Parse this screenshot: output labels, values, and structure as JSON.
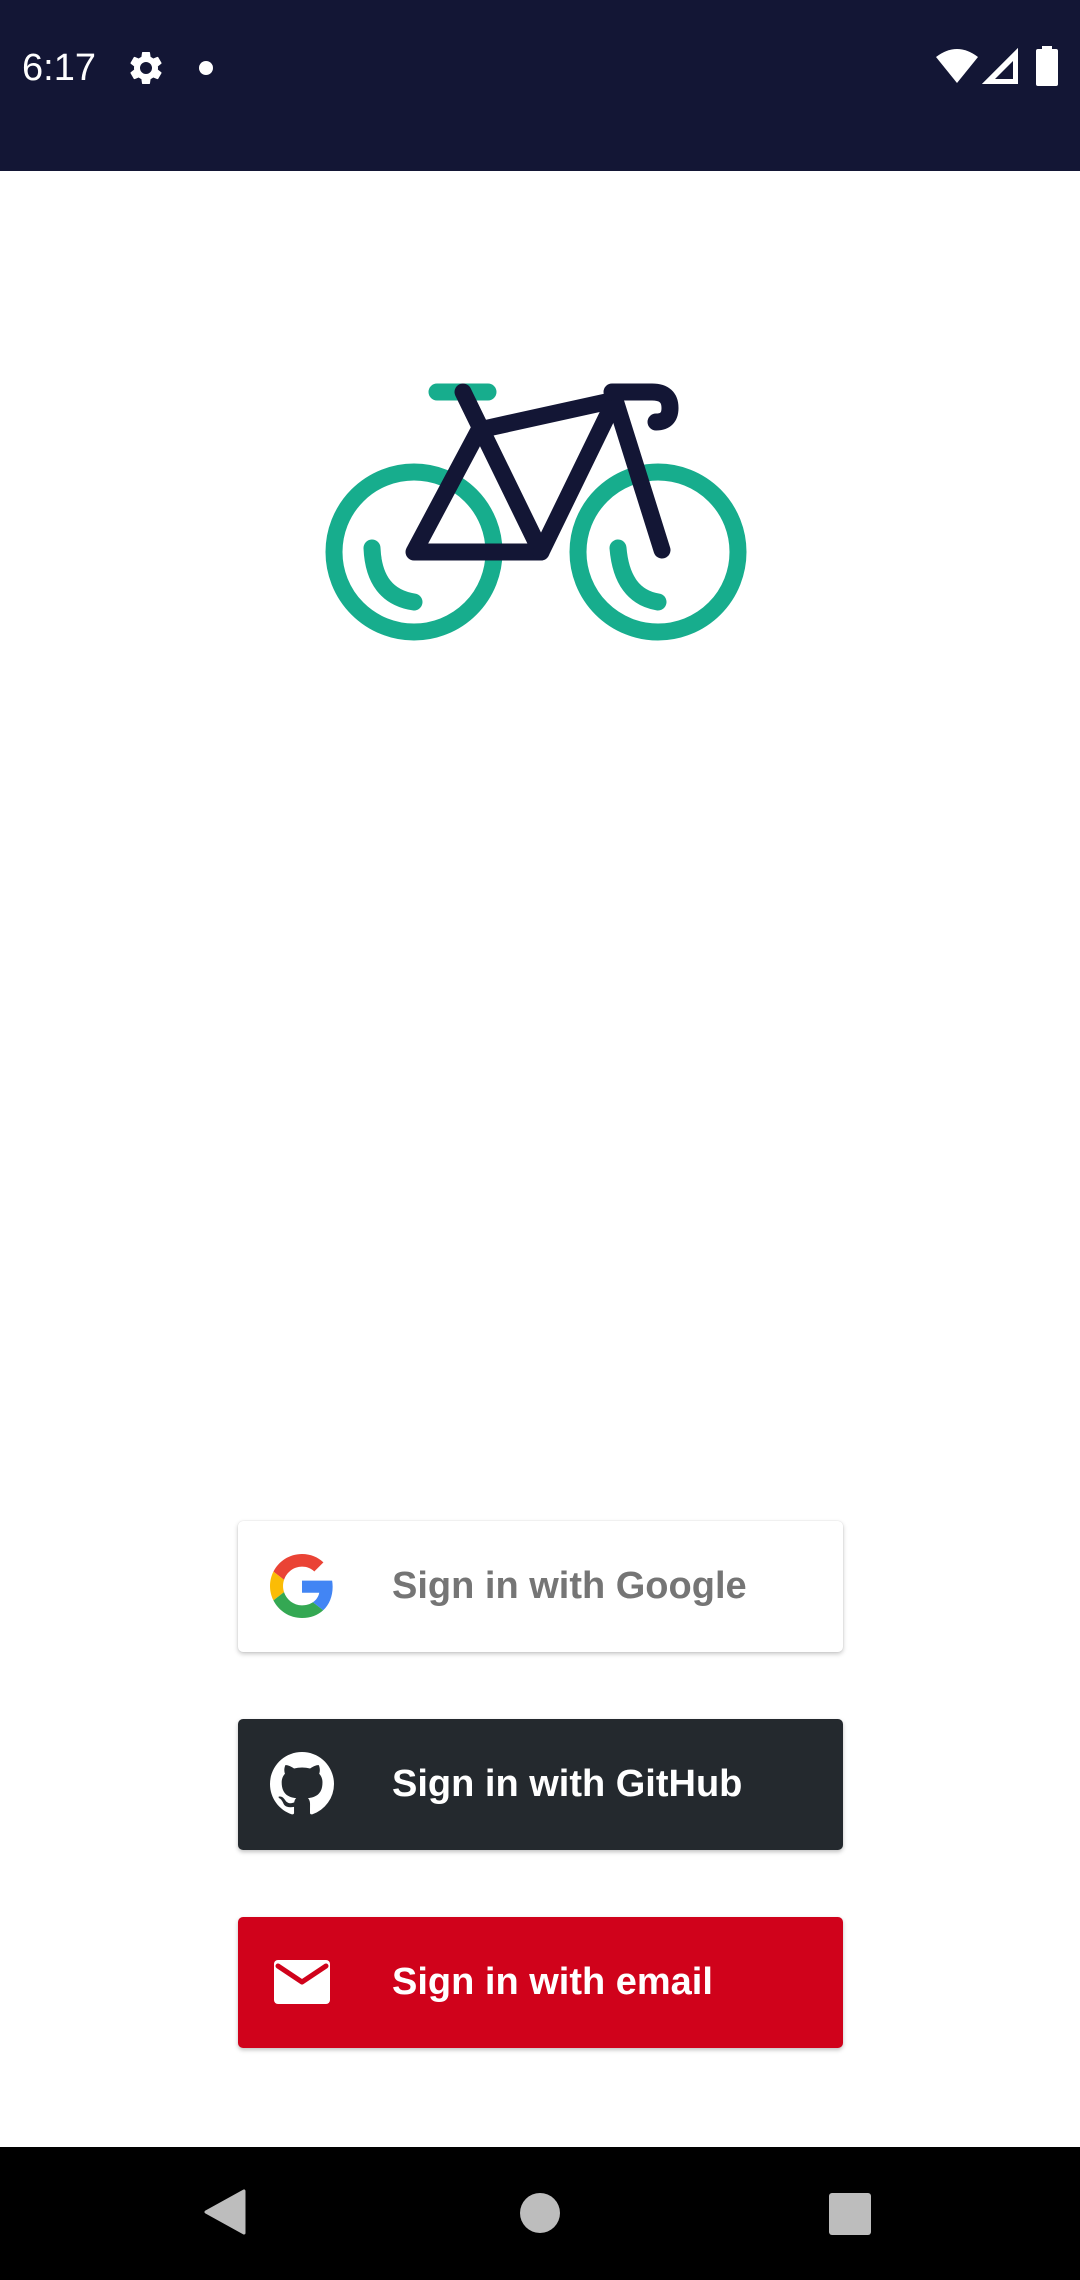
{
  "status_bar": {
    "time": "6:17",
    "icons": [
      "gear-icon",
      "notification-dot-icon",
      "wifi-icon",
      "signal-icon",
      "battery-icon"
    ],
    "background_color": "#131635"
  },
  "logo": {
    "icon": "bicycle-icon",
    "colors": {
      "wheels": "#17ad8d",
      "frame": "#131635"
    }
  },
  "auth_buttons": [
    {
      "provider": "google",
      "label": "Sign in with Google",
      "icon": "google-g-icon",
      "background": "#ffffff",
      "text_color": "#757575"
    },
    {
      "provider": "github",
      "label": "Sign in with GitHub",
      "icon": "github-icon",
      "background": "#24292e",
      "text_color": "#ffffff"
    },
    {
      "provider": "email",
      "label": "Sign in with email",
      "icon": "mail-icon",
      "background": "#d0021b",
      "text_color": "#ffffff"
    }
  ],
  "nav_bar": {
    "buttons": [
      "back-icon",
      "home-icon",
      "recents-icon"
    ]
  }
}
